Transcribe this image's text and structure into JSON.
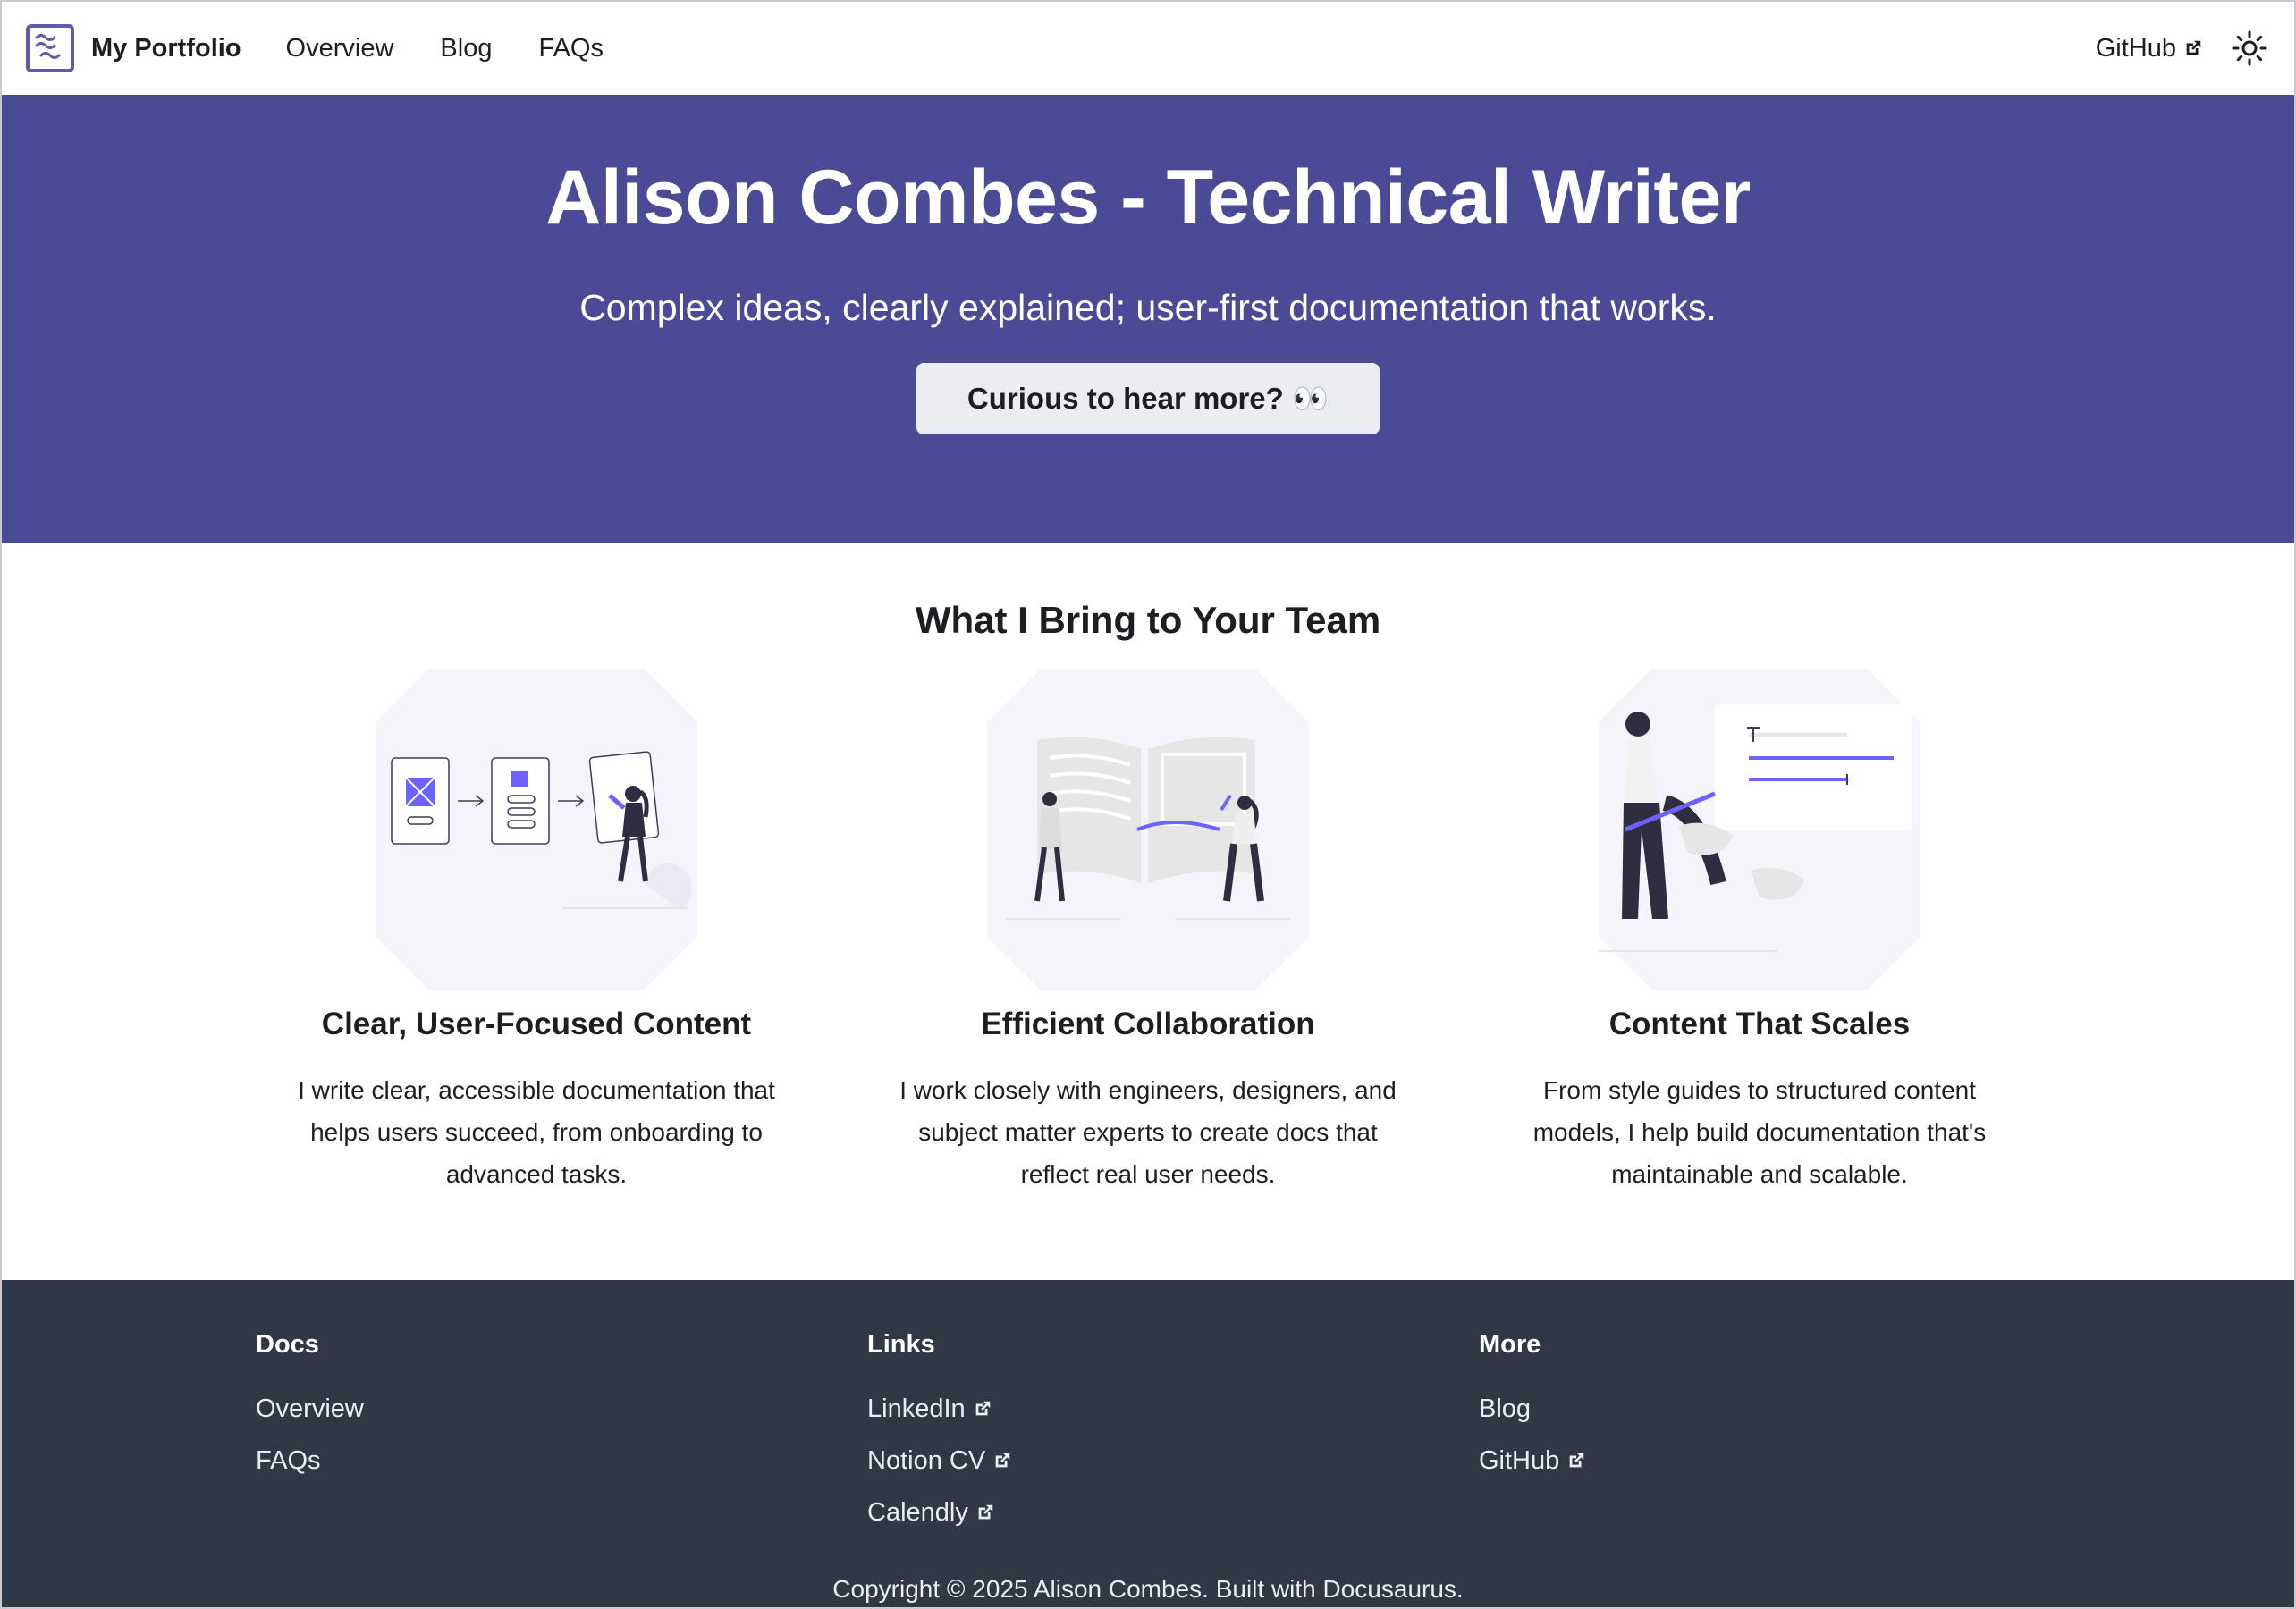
{
  "navbar": {
    "brand_title": "My Portfolio",
    "links": [
      {
        "label": "Overview"
      },
      {
        "label": "Blog"
      },
      {
        "label": "FAQs"
      }
    ],
    "github_label": "GitHub",
    "theme_icon": "sun-icon"
  },
  "hero": {
    "title": "Alison Combes - Technical Writer",
    "subtitle": "Complex ideas, clearly explained; user-first documentation that works.",
    "cta_label": "Curious to hear more? 👀",
    "background_color": "#4b4a96"
  },
  "features": {
    "heading": "What I Bring to Your Team",
    "items": [
      {
        "title": "Clear, User-Focused Content",
        "description": "I write clear, accessible documentation that helps users succeed, from onboarding to advanced tasks.",
        "illustration": "wireframe-illustration"
      },
      {
        "title": "Efficient Collaboration",
        "description": "I work closely with engineers, designers, and subject matter experts to create docs that reflect real user needs.",
        "illustration": "open-book-illustration"
      },
      {
        "title": "Content That Scales",
        "description": "From style guides to structured content models, I help build documentation that's maintainable and scalable.",
        "illustration": "text-editing-illustration"
      }
    ],
    "accent_color": "#6c63ff"
  },
  "footer": {
    "columns": [
      {
        "title": "Docs",
        "items": [
          {
            "label": "Overview",
            "external": false
          },
          {
            "label": "FAQs",
            "external": false
          }
        ]
      },
      {
        "title": "Links",
        "items": [
          {
            "label": "LinkedIn",
            "external": true
          },
          {
            "label": "Notion CV",
            "external": true
          },
          {
            "label": "Calendly",
            "external": true
          }
        ]
      },
      {
        "title": "More",
        "items": [
          {
            "label": "Blog",
            "external": false
          },
          {
            "label": "GitHub",
            "external": true
          }
        ]
      }
    ],
    "copyright": "Copyright © 2025 Alison Combes. Built with Docusaurus.",
    "background_color": "#303846"
  }
}
